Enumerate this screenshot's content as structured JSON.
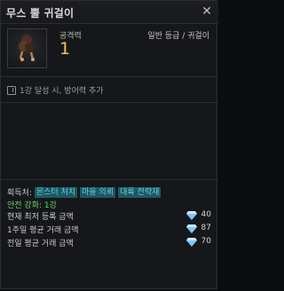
{
  "item": {
    "name": "무스 뿔 귀걸이",
    "stat_label": "공격력",
    "stat_value": "1",
    "grade": "일반 등급 / 귀걸이",
    "set_effect": "1강 달성 시, 방어력 추가",
    "acquire_label": "획득처:",
    "acquire_tags": [
      "몬스터 처치",
      "마을 의뢰",
      "대륙 전략재"
    ],
    "safe_enhance": "안전 강화: 1강"
  },
  "prices": [
    {
      "label": "현재 최저 등록 금액",
      "value": "40"
    },
    {
      "label": "1주일 평균 거래 금액",
      "value": "87"
    },
    {
      "label": "전일 평균 거래 금액",
      "value": "70"
    }
  ],
  "colors": {
    "value_gold": "#f0c94d",
    "tag_cyan": "#5fd0dc",
    "safe_green": "#66d85c",
    "gem_blue": "#7fc6ff"
  }
}
